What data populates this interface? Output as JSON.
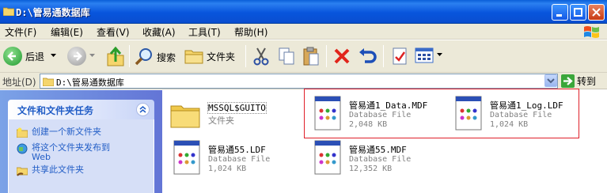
{
  "window": {
    "title": "D:\\管易通数据库"
  },
  "menu": [
    {
      "label": "文件(F)"
    },
    {
      "label": "编辑(E)"
    },
    {
      "label": "查看(V)"
    },
    {
      "label": "收藏(A)"
    },
    {
      "label": "工具(T)"
    },
    {
      "label": "帮助(H)"
    }
  ],
  "toolbar": {
    "back_label": "后退",
    "search_label": "搜索",
    "folders_label": "文件夹"
  },
  "address": {
    "label": "地址(D)",
    "value": "D:\\管易通数据库",
    "go_label": "转到"
  },
  "tasks": {
    "title": "文件和文件夹任务",
    "items": [
      {
        "label": "创建一个新文件夹"
      },
      {
        "label": "将这个文件夹发布到"
      },
      {
        "label": "Web"
      },
      {
        "label": "共享此文件夹"
      }
    ]
  },
  "files": [
    {
      "name": "MSSQL$GUITO",
      "type": "文件夹",
      "size": ""
    },
    {
      "name": "管易通1_Data.MDF",
      "type": "Database File",
      "size": "2,048 KB"
    },
    {
      "name": "管易通1_Log.LDF",
      "type": "Database File",
      "size": "1,024 KB"
    },
    {
      "name": "管易通55.LDF",
      "type": "Database File",
      "size": "1,024 KB"
    },
    {
      "name": "管易通55.MDF",
      "type": "Database File",
      "size": "12,352 KB"
    }
  ],
  "colors": {
    "titlebar": "#0855dd",
    "panel": "#ece9d8",
    "task_link": "#215dc6",
    "highlight": "#e0202a"
  }
}
